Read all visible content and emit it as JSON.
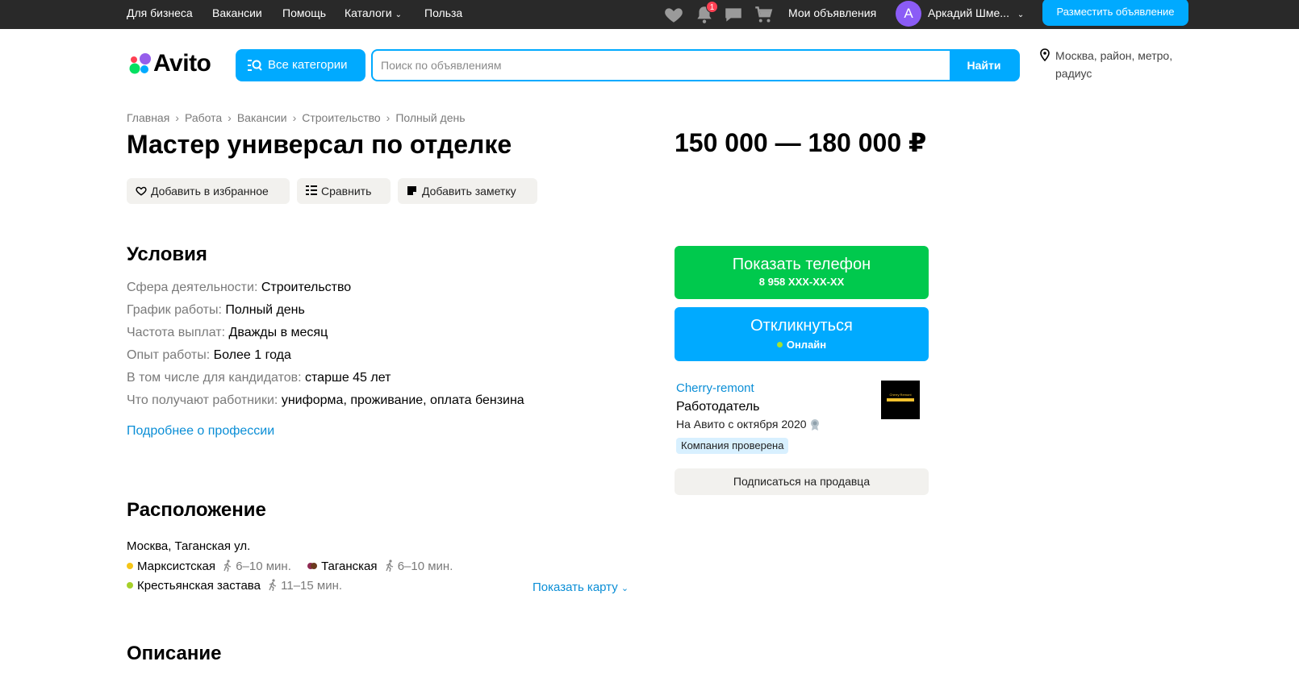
{
  "topbar": {
    "links": [
      "Для бизнеса",
      "Вакансии",
      "Помощь",
      "Каталоги",
      "Польза"
    ],
    "notifications_count": "1",
    "my_ads": "Мои объявления",
    "avatar_letter": "А",
    "user_name": "Аркадий Шме...",
    "post_ad": "Разместить объявление"
  },
  "header": {
    "logo": "Avito",
    "categories_button": "Все категории",
    "search_placeholder": "Поиск по объявлениям",
    "search_value": "",
    "search_button": "Найти",
    "location": "Москва, район, метро, радиус"
  },
  "breadcrumbs": [
    "Главная",
    "Работа",
    "Вакансии",
    "Строительство",
    "Полный день"
  ],
  "listing": {
    "title": "Мастер универсал по отделке",
    "price": "150 000 — 180 000 ₽",
    "actions": {
      "favorite": "Добавить в избранное",
      "compare": "Сравнить",
      "note": "Добавить заметку"
    }
  },
  "conditions": {
    "heading": "Условия",
    "rows": [
      {
        "key": "Сфера деятельности:",
        "value": "Строительство"
      },
      {
        "key": "График работы:",
        "value": "Полный день"
      },
      {
        "key": "Частота выплат:",
        "value": "Дважды в месяц"
      },
      {
        "key": "Опыт работы:",
        "value": "Более 1 года"
      },
      {
        "key": "В том числе для кандидатов:",
        "value": "старше 45 лет"
      },
      {
        "key": "Что получают работники:",
        "value": "униформа, проживание, оплата бензина"
      }
    ],
    "more_link": "Подробнее о профессии"
  },
  "location": {
    "heading": "Расположение",
    "address": "Москва, Таганская ул.",
    "metro": [
      {
        "name": "Марксистская",
        "time": "6–10 мин.",
        "color": "#f5c518"
      },
      {
        "name": "Таганская",
        "time": "6–10 мин.",
        "color": "#8e2a52"
      },
      {
        "name": "Крестьянская застава",
        "time": "11–15 мин.",
        "color": "#a6d02a"
      }
    ],
    "show_map": "Показать карту"
  },
  "description": {
    "heading": "Описание"
  },
  "contact": {
    "phone_label": "Показать телефон",
    "phone_number": "8 958 XXX-XX-XX",
    "reply_label": "Откликнуться",
    "reply_status": "Онлайн"
  },
  "seller": {
    "name": "Cherry-remont",
    "role": "Работодатель",
    "since": "На Авито с октября 2020",
    "verified": "Компания проверена",
    "subscribe": "Подписаться на продавца",
    "logo_text": "Cherry Remont"
  },
  "colors": {
    "accent": "#00aaff",
    "green": "#00c94d",
    "link": "#0a8ed6",
    "topbar": "#292929"
  }
}
